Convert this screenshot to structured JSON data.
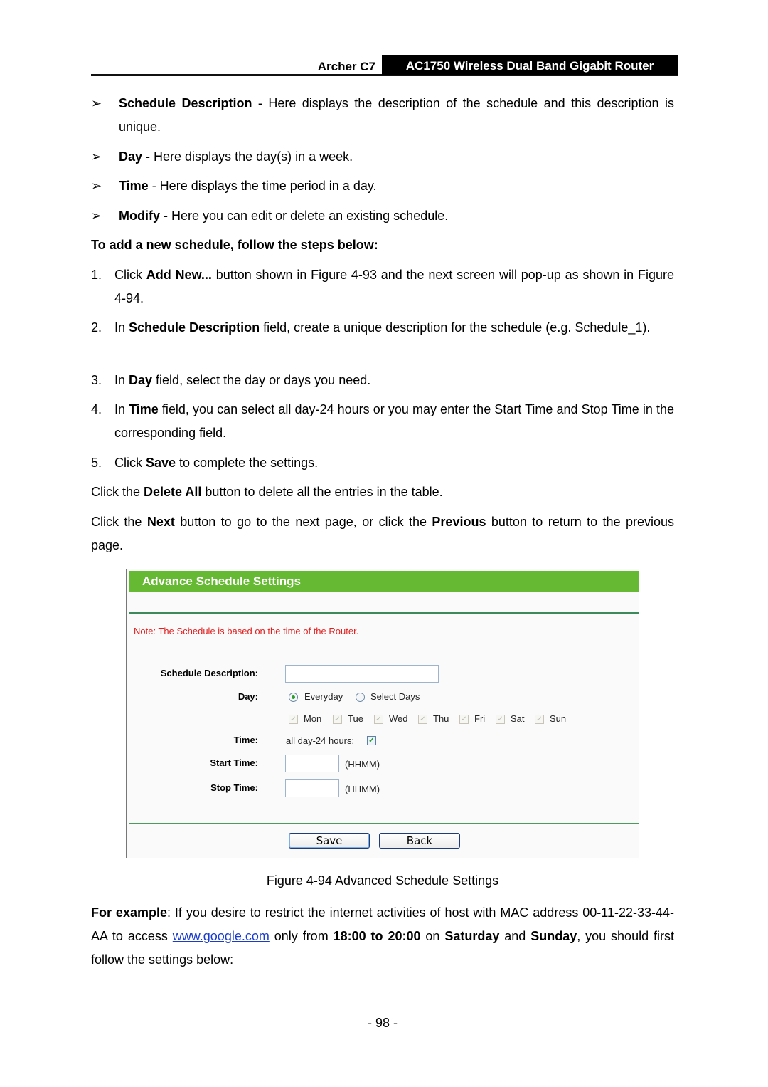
{
  "header": {
    "model": "Archer C7",
    "product": "AC1750 Wireless Dual Band Gigabit Router"
  },
  "bullets": [
    {
      "term": "Schedule Description",
      "text": " - Here displays the description of the schedule and this description is unique."
    },
    {
      "term": "Day",
      "text": " - Here displays the day(s) in a week."
    },
    {
      "term": "Time",
      "text": " - Here displays the time period in a day."
    },
    {
      "term": "Modify",
      "text": " - Here you can edit or delete an existing schedule."
    }
  ],
  "arrow_glyph": "➢",
  "steps_heading": "To add a new schedule, follow the steps below:",
  "steps": [
    {
      "n": "1.",
      "pre": "Click ",
      "bold": "Add New...",
      "post": " button shown in Figure 4-93 and the next screen will pop-up as shown in Figure 4-94."
    },
    {
      "n": "2.",
      "pre": "In ",
      "bold": "Schedule Description",
      "post": " field, create a unique description for the schedule (e.g. Schedule_1)."
    },
    {
      "n": "3.",
      "pre": "In ",
      "bold": "Day",
      "post": " field, select the day or days you need."
    },
    {
      "n": "4.",
      "pre": "In ",
      "bold": "Time",
      "post": " field, you can select all day-24 hours or you may enter the Start Time and Stop Time in the corresponding field."
    },
    {
      "n": "5.",
      "pre": "Click ",
      "bold": "Save",
      "post": " to complete the settings."
    }
  ],
  "para_delete": {
    "pre": "Click the ",
    "bold": "Delete All",
    "post": " button to delete all the entries in the table."
  },
  "para_nav": {
    "pre": "Click the ",
    "bold1": "Next",
    "mid": " button to go to the next page, or click the ",
    "bold2": "Previous",
    "post": " button to return to the previous page."
  },
  "figure": {
    "title": "Advance Schedule Settings",
    "note": "Note: The Schedule is based on the time of the Router.",
    "labels": {
      "description": "Schedule Description:",
      "day": "Day:",
      "time": "Time:",
      "start": "Start Time:",
      "stop": "Stop Time:"
    },
    "description_value": "",
    "day_options": [
      {
        "label": "Everyday",
        "selected": true
      },
      {
        "label": "Select Days",
        "selected": false
      }
    ],
    "days": [
      {
        "label": "Mon",
        "checked": true
      },
      {
        "label": "Tue",
        "checked": true
      },
      {
        "label": "Wed",
        "checked": true
      },
      {
        "label": "Thu",
        "checked": true
      },
      {
        "label": "Fri",
        "checked": true
      },
      {
        "label": "Sat",
        "checked": true
      },
      {
        "label": "Sun",
        "checked": true
      }
    ],
    "allday_label": "all day-24 hours:",
    "allday_checked": true,
    "start_value": "",
    "stop_value": "",
    "format_hint": "(HHMM)",
    "buttons": {
      "save": "Save",
      "back": "Back"
    },
    "caption": "Figure 4-94 Advanced Schedule Settings"
  },
  "example": {
    "bold1": "For example",
    "t1": ": If you desire to restrict the internet activities of host with MAC address 00-11-22-33-44-AA to access ",
    "link": "www.google.com",
    "t2": " only from ",
    "bold2": "18:00 to 20:00",
    "t3": " on ",
    "bold3": "Saturday",
    "t4": " and ",
    "bold4": "Sunday",
    "t5": ", you should first follow the settings below:"
  },
  "page_number": "- 98 -",
  "colors": {
    "title_bar": "#66b933",
    "note": "#e02020",
    "link": "#1a3ccc"
  }
}
